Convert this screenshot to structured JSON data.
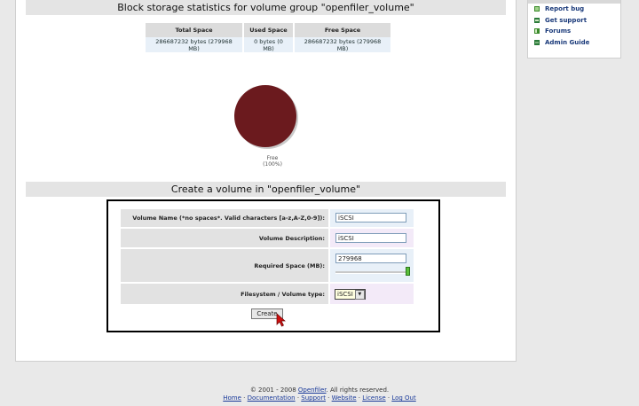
{
  "side_panel": {
    "items": [
      {
        "label": "Report bug",
        "icon": "bug-report-icon"
      },
      {
        "label": "Get support",
        "icon": "support-icon"
      },
      {
        "label": "Forums",
        "icon": "forums-icon"
      },
      {
        "label": "Admin Guide",
        "icon": "admin-guide-icon"
      }
    ]
  },
  "stats_section": {
    "title": "Block storage statistics for volume group \"openfiler_volume\"",
    "headers": [
      "Total Space",
      "Used Space",
      "Free Space"
    ],
    "values": [
      "286687232 bytes (279968 MB)",
      "0 bytes (0 MB)",
      "286687232 bytes (279968 MB)"
    ]
  },
  "chart_data": {
    "type": "pie",
    "slices": [
      {
        "label": "Free",
        "percent_label": "(100%)",
        "value": 100,
        "color": "#6b1a1e"
      }
    ]
  },
  "create_section": {
    "title": "Create a volume in \"openfiler_volume\"",
    "fields": [
      {
        "label": "Volume Name (*no spaces*. Valid characters [a-z,A-Z,0-9]):",
        "value": "iSCSI"
      },
      {
        "label": "Volume Description:",
        "value": "iSCSI"
      },
      {
        "label": "Required Space (MB):",
        "value": "279968"
      },
      {
        "label": "Filesystem / Volume type:",
        "value": "iSCSI"
      }
    ],
    "slider_fraction": 1.0,
    "button_label": "Create"
  },
  "footer": {
    "copyright_prefix": "© 2001 - 2008",
    "brand": "Openfiler",
    "copyright_suffix": ". All rights reserved.",
    "links": [
      "Home",
      "Documentation",
      "Support",
      "Website",
      "License",
      "Log Out"
    ],
    "separator": " · "
  },
  "colors": {
    "pie_fill": "#6b1a1e",
    "slider_thumb": "#5bbf3a",
    "link": "#1a3a9a"
  }
}
